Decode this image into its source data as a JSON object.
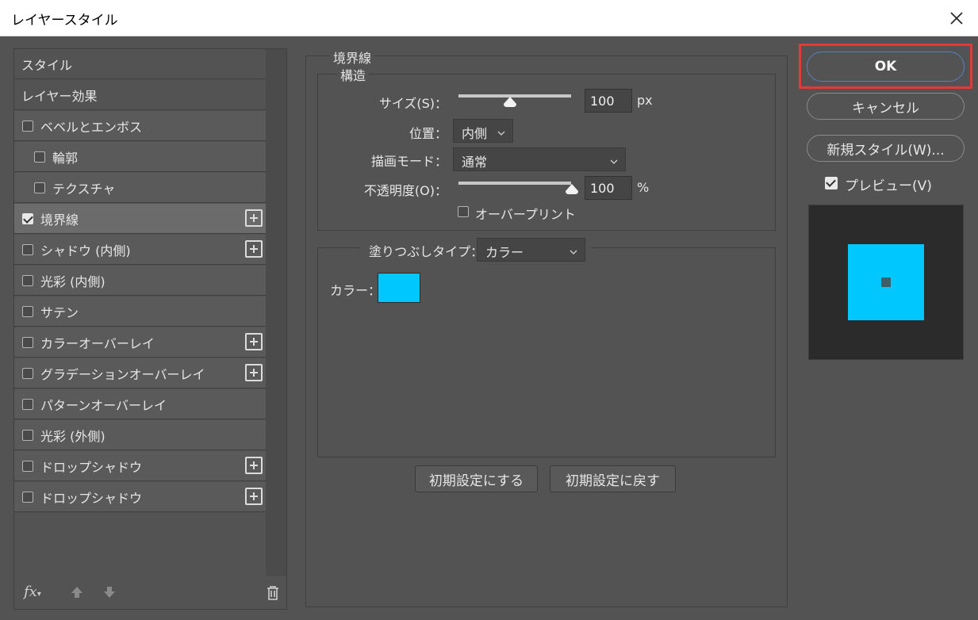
{
  "window": {
    "title": "レイヤースタイル"
  },
  "styles_list": {
    "items": [
      {
        "label": "スタイル",
        "type": "header"
      },
      {
        "label": "レイヤー効果",
        "type": "header"
      },
      {
        "label": "ベベルとエンボス",
        "checked": false,
        "plus": false
      },
      {
        "label": "輪郭",
        "checked": false,
        "plus": false,
        "indent": true
      },
      {
        "label": "テクスチャ",
        "checked": false,
        "plus": false,
        "indent": true
      },
      {
        "label": "境界線",
        "checked": true,
        "plus": true,
        "selected": true
      },
      {
        "label": "シャドウ (内側)",
        "checked": false,
        "plus": true
      },
      {
        "label": "光彩 (内側)",
        "checked": false,
        "plus": false
      },
      {
        "label": "サテン",
        "checked": false,
        "plus": false
      },
      {
        "label": "カラーオーバーレイ",
        "checked": false,
        "plus": true
      },
      {
        "label": "グラデーションオーバーレイ",
        "checked": false,
        "plus": true
      },
      {
        "label": "パターンオーバーレイ",
        "checked": false,
        "plus": false
      },
      {
        "label": "光彩 (外側)",
        "checked": false,
        "plus": false
      },
      {
        "label": "ドロップシャドウ",
        "checked": false,
        "plus": true
      },
      {
        "label": "ドロップシャドウ",
        "checked": false,
        "plus": true
      }
    ],
    "fx_label": "fx"
  },
  "stroke": {
    "group_title": "境界線",
    "structure_title": "構造",
    "size_label": "サイズ(S)：",
    "size_value": "100",
    "size_unit": "px",
    "size_slider_fraction": 0.45,
    "position_label": "位置：",
    "position_value": "内側",
    "blend_label": "描画モード：",
    "blend_value": "通常",
    "opacity_label": "不透明度(O)：",
    "opacity_value": "100",
    "opacity_unit": "%",
    "opacity_slider_fraction": 1.0,
    "overprint_label": "オーバープリント",
    "overprint_checked": false,
    "fill_type_label": "塗りつぶしタイプ：",
    "fill_type_value": "カラー",
    "color_label": "カラー：",
    "color_hex": "#00c8ff",
    "reset_default_label": "初期設定にする",
    "restore_default_label": "初期設定に戻す"
  },
  "actions": {
    "ok_label": "OK",
    "cancel_label": "キャンセル",
    "new_style_label": "新規スタイル(W)...",
    "preview_label": "プレビュー(V)",
    "preview_checked": true
  },
  "colors": {
    "highlight": "#e53935",
    "stroke_color": "#00c8ff"
  }
}
